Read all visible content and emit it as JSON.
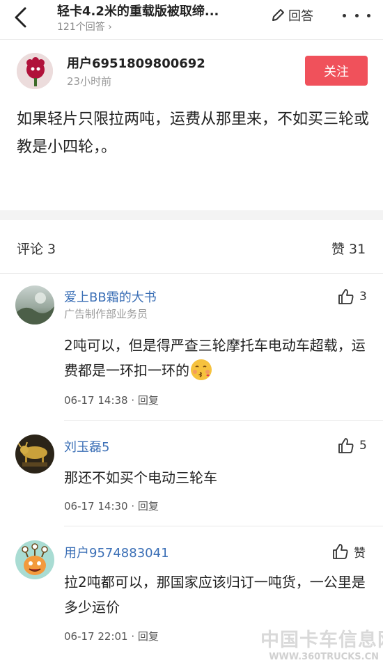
{
  "header": {
    "title": "轻卡4.2米的重载版被取缔...",
    "answer_count": "121个回答 ›",
    "answer_label": "回答"
  },
  "answer": {
    "author_name": "用户6951809800692",
    "time": "23小时前",
    "follow_label": "关注",
    "text": "如果轻片只限拉两吨，运费从那里来，不如买三轮或教是小四轮，。"
  },
  "comments_bar": {
    "count_label": "评论 3",
    "likes_label": "赞 31"
  },
  "comments": [
    {
      "name": "爱上BB霜的大书",
      "role": "广告制作部业务员",
      "text": "2吨可以，但是得严查三轮摩托车电动车超载，运费都是一环扣一环的",
      "emoji": "kiss-emoji",
      "time": "06-17 14:38 · 回复",
      "likes": "3"
    },
    {
      "name": "刘玉磊5",
      "text": "那还不如买个电动三轮车",
      "time": "06-17 14:30 · 回复",
      "likes": "5"
    },
    {
      "name": "用户9574883041",
      "text": "拉2吨都可以，那国家应该归订一吨货，一公里是多少运价",
      "time": "06-17 22:01 · 回复",
      "likes": "赞"
    }
  ],
  "watermark": {
    "name": "中国卡车信息网",
    "url": "WWW.360TRUCKS.CN"
  },
  "colors": {
    "follow_bg": "#f0515b",
    "name_blue": "#3b6fb6",
    "muted_gray": "#999999"
  }
}
